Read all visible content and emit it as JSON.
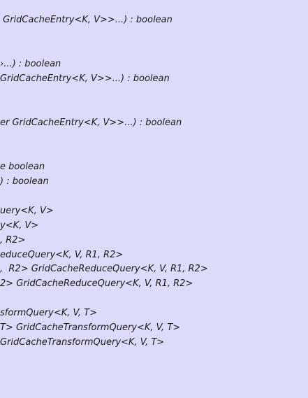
{
  "uml_class_methods": {
    "lines": [
      " GridCacheEntry<K, V>>...) : boolean",
      "›...) : boolean",
      "GridCacheEntry<K, V>>...) : boolean",
      "er GridCacheEntry<K, V>>...) : boolean",
      "e boolean",
      ") : boolean",
      "uery<K, V>",
      "y<K, V>",
      ", R2>",
      "educeQuery<K, V, R1, R2>",
      ",  R2> GridCacheReduceQuery<K, V, R1, R2>",
      "2> GridCacheReduceQuery<K, V, R1, R2>",
      "sformQuery<K, V, T>",
      "T> GridCacheTransformQuery<K, V, T>",
      "GridCacheTransformQuery<K, V, T>"
    ]
  }
}
